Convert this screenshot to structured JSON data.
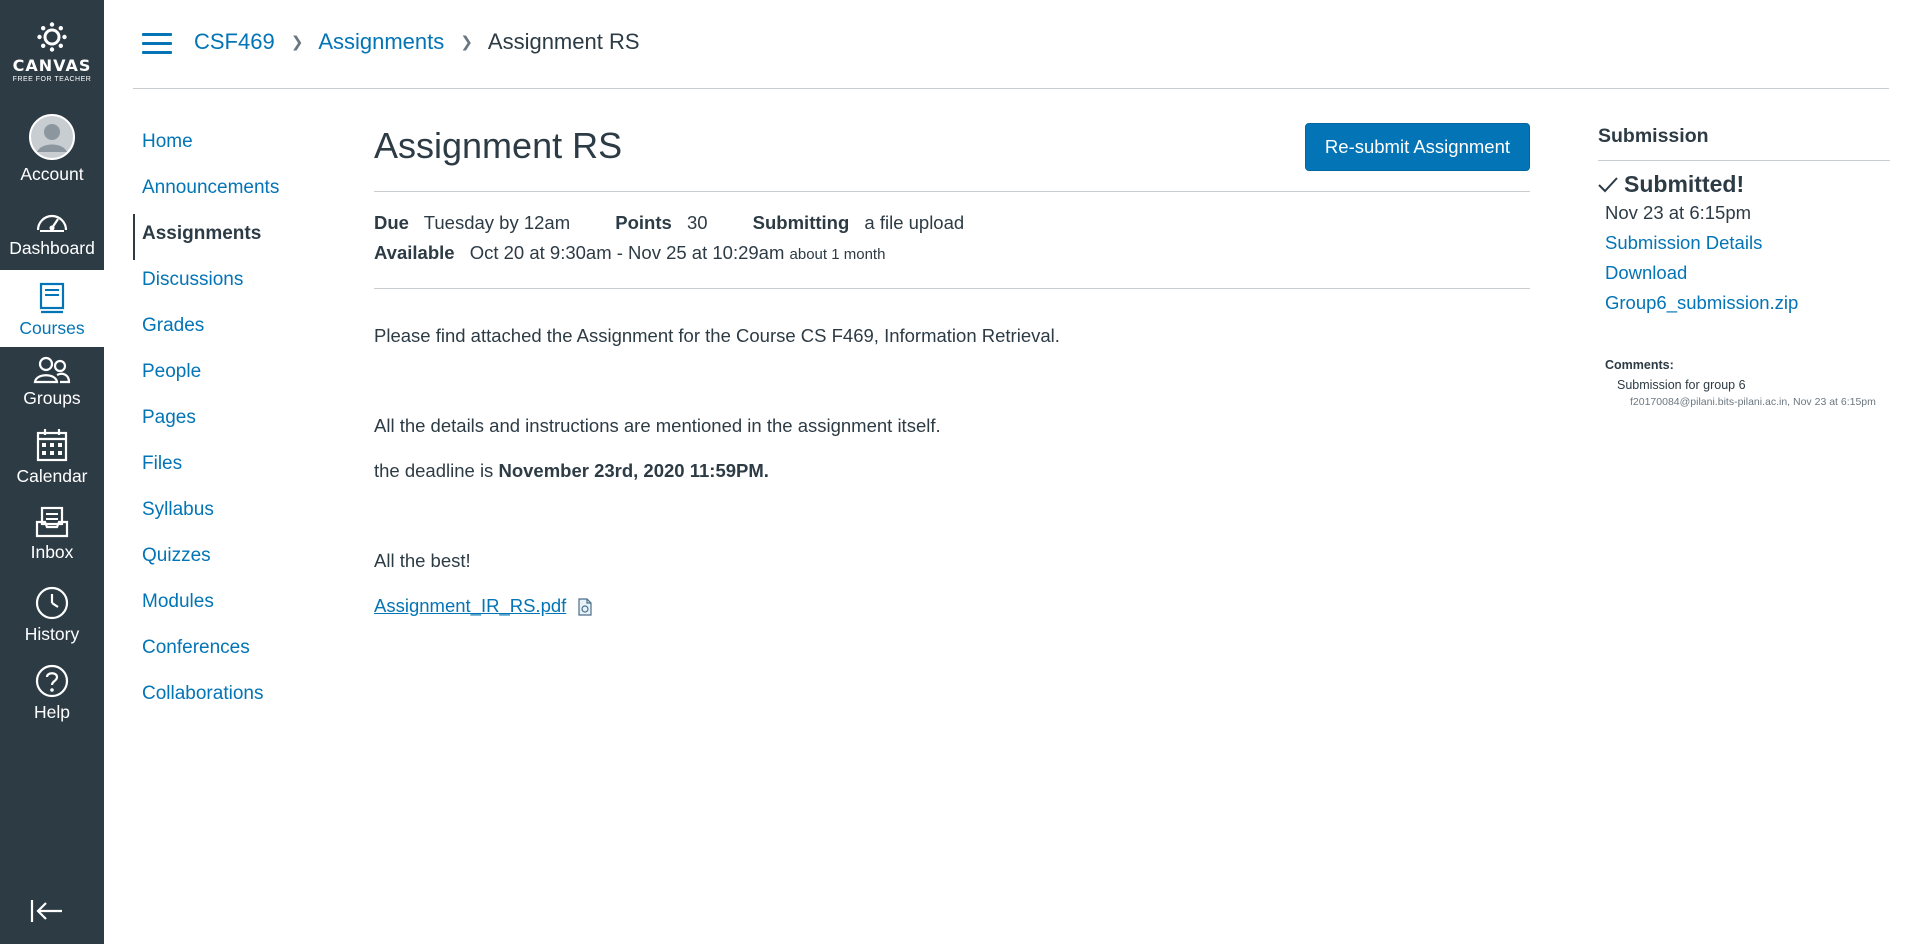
{
  "global_nav": {
    "logo": {
      "wordmark": "CANVAS",
      "subtitle": "FREE FOR TEACHER"
    },
    "items": [
      {
        "label": "Account",
        "icon": "avatar-icon"
      },
      {
        "label": "Dashboard",
        "icon": "dashboard-icon"
      },
      {
        "label": "Courses",
        "icon": "courses-icon",
        "active": true
      },
      {
        "label": "Groups",
        "icon": "groups-icon"
      },
      {
        "label": "Calendar",
        "icon": "calendar-icon"
      },
      {
        "label": "Inbox",
        "icon": "inbox-icon"
      },
      {
        "label": "History",
        "icon": "history-icon"
      },
      {
        "label": "Help",
        "icon": "help-icon"
      }
    ]
  },
  "breadcrumb": {
    "course": "CSF469",
    "section": "Assignments",
    "current": "Assignment RS"
  },
  "course_nav": [
    "Home",
    "Announcements",
    "Assignments",
    "Discussions",
    "Grades",
    "People",
    "Pages",
    "Files",
    "Syllabus",
    "Quizzes",
    "Modules",
    "Conferences",
    "Collaborations"
  ],
  "assignment": {
    "title": "Assignment RS",
    "resubmit_label": "Re-submit Assignment",
    "due_label": "Due",
    "due_value": "Tuesday by 12am",
    "points_label": "Points",
    "points_value": "30",
    "submitting_label": "Submitting",
    "submitting_value": "a file upload",
    "available_label": "Available",
    "available_value": "Oct 20 at 9:30am - Nov 25 at 10:29am",
    "available_duration": "about 1 month",
    "description": {
      "p1": "Please find attached the Assignment for the Course CS F469, Information Retrieval.",
      "p2": "All the details and instructions are mentioned in the assignment itself.",
      "p3_prefix": "the deadline is ",
      "p3_bold": "November 23rd, 2020 11:59PM.",
      "p4": "All the best!",
      "attachment": "Assignment_IR_RS.pdf"
    }
  },
  "submission": {
    "heading": "Submission",
    "status": "Submitted!",
    "date": "Nov 23 at 6:15pm",
    "details_link": "Submission Details",
    "download_link": "Download",
    "file_link": "Group6_submission.zip",
    "comments_heading": "Comments:",
    "comment_text": "Submission for group 6",
    "comment_meta": "f20170084@pilani.bits-pilani.ac.in, Nov 23 at 6:15pm"
  },
  "colors": {
    "nav_bg": "#2d3b45",
    "link": "#0374b5",
    "button": "#0374b5",
    "text": "#2d3b45"
  }
}
